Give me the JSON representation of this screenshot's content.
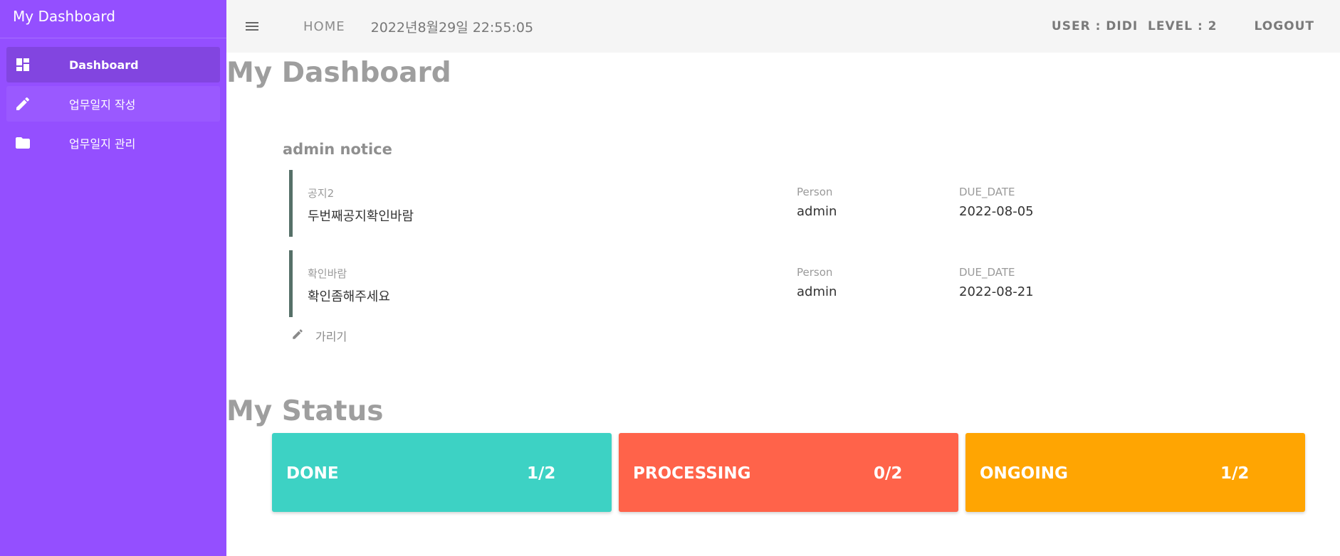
{
  "sidebar": {
    "title": "My Dashboard",
    "items": [
      {
        "label": "Dashboard",
        "icon": "dashboard-icon",
        "active": true
      },
      {
        "label": "업무일지 작성",
        "icon": "pencil-icon",
        "active": false
      },
      {
        "label": "업무일지 관리",
        "icon": "folder-icon",
        "active": false
      }
    ]
  },
  "topbar": {
    "home_label": "HOME",
    "datetime": "2022년8월29일 22:55:05",
    "user_info": "USER : DIDI  LEVEL : 2",
    "logout_label": "LOGOUT"
  },
  "main": {
    "page_title": "My Dashboard",
    "notice_section": {
      "title": "admin notice",
      "notices": [
        {
          "subject": "공지2",
          "content": "두번째공지확인바람",
          "person_label": "Person",
          "person": "admin",
          "due_label": "DUE_DATE",
          "due_date": "2022-08-05"
        },
        {
          "subject": "확인바람",
          "content": "확인좀해주세요",
          "person_label": "Person",
          "person": "admin",
          "due_label": "DUE_DATE",
          "due_date": "2022-08-21"
        }
      ],
      "hide_label": "가리기"
    },
    "status_title": "My Status",
    "status_cards": [
      {
        "label": "DONE",
        "count": "1/2",
        "color": "#3dd2c4"
      },
      {
        "label": "PROCESSING",
        "count": "0/2",
        "color": "#ff634a"
      },
      {
        "label": "ONGOING",
        "count": "1/2",
        "color": "#ffa502"
      }
    ]
  },
  "colors": {
    "sidebar_bg": "#944fff",
    "topbar_bg": "#f5f5f5",
    "notice_border": "#567068"
  }
}
